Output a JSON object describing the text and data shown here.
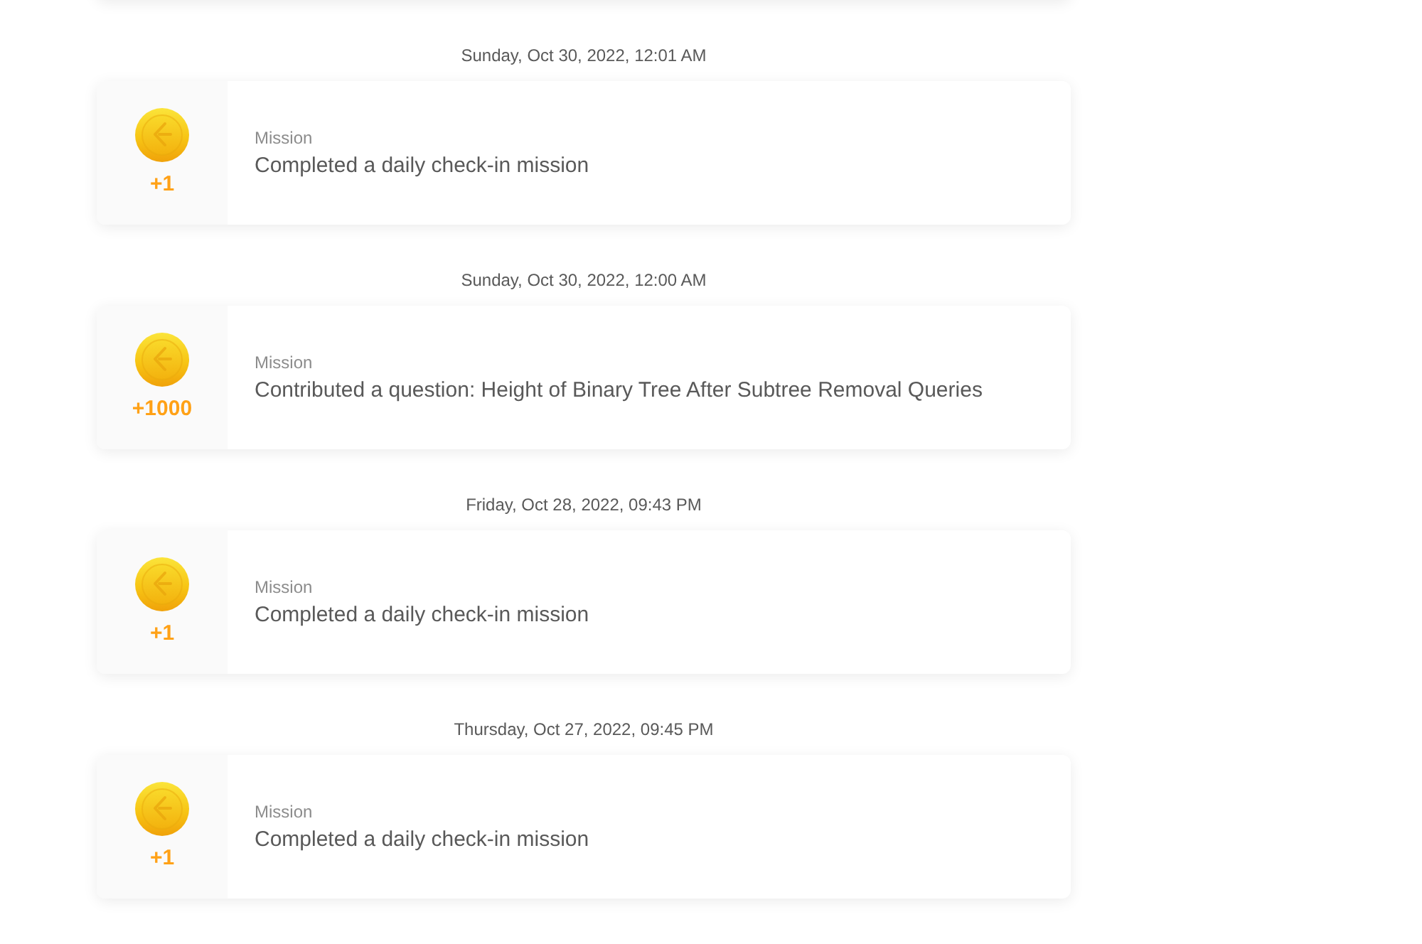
{
  "entries": [
    {
      "date": "Sunday, Oct 30, 2022, 12:01 AM",
      "amount": "+1",
      "category": "Mission",
      "description": "Completed a daily check-in mission"
    },
    {
      "date": "Sunday, Oct 30, 2022, 12:00 AM",
      "amount": "+1000",
      "category": "Mission",
      "description": "Contributed a question: Height of Binary Tree After Subtree Removal Queries"
    },
    {
      "date": "Friday, Oct 28, 2022, 09:43 PM",
      "amount": "+1",
      "category": "Mission",
      "description": "Completed a daily check-in mission"
    },
    {
      "date": "Thursday, Oct 27, 2022, 09:45 PM",
      "amount": "+1",
      "category": "Mission",
      "description": "Completed a daily check-in mission"
    }
  ]
}
